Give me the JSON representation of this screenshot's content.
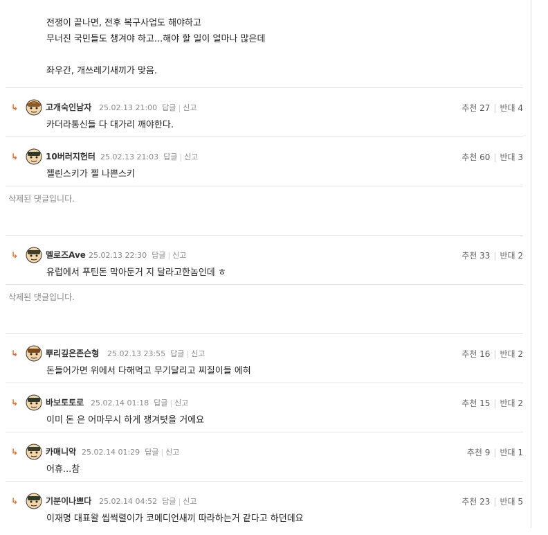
{
  "parent_text": {
    "line1": "전쟁이 끝나면, 전후 복구사업도 해야하고",
    "line2": "무너진 국민들도 챙겨야 하고...해야 할 일이 얼마나 많은데",
    "line3": "좌우간, 개쓰레기새끼가 맞음."
  },
  "labels": {
    "reply": "답글",
    "report": "신고",
    "recommend": "추천",
    "oppose": "반대",
    "deleted": "삭제된 댓글입니다.",
    "reply_arrow": "↳"
  },
  "comments": [
    {
      "nick": "고개숙인남자",
      "date": "25.02.13 21:00",
      "text": "카더라통신들 다 대가리 깨야한다.",
      "up": "27",
      "down": "4"
    },
    {
      "nick": "10버러지헌터",
      "date": "25.02.13 21:03",
      "text": "젤린스키가 젤 나쁜스키",
      "up": "60",
      "down": "3"
    },
    {
      "nick": "멜로즈Ave",
      "date": "25.02.13 22:30",
      "text": "유럽에서 푸틴돈 막아둔거 지 달라고한놈인데 ㅎ",
      "up": "33",
      "down": "2"
    },
    {
      "nick": "뿌리깊은존슨형",
      "date": "25.02.13 23:55",
      "text": "돈들어가면 위에서 다해먹고 무기달리고 찌질이들 에혀",
      "up": "16",
      "down": "2"
    },
    {
      "nick": "바보토토로",
      "date": "25.02.14 01:18",
      "text": "이미 돈 은 어마무시 하게 쟁겨텻을 거에요",
      "up": "15",
      "down": "2"
    },
    {
      "nick": "카매니악",
      "date": "25.02.14 01:29",
      "text": "어휴...참",
      "up": "9",
      "down": "1"
    },
    {
      "nick": "기분이나쁘다",
      "date": "25.02.14 04:52",
      "text": "이재명 대표왈 씹썩렬이가 코메디언새끼 따라하는거 같다고 하던데요",
      "up": "23",
      "down": "5"
    }
  ],
  "colors": {
    "accent": "#e8692a",
    "muted": "#888888",
    "divider": "#e3e3e3"
  }
}
